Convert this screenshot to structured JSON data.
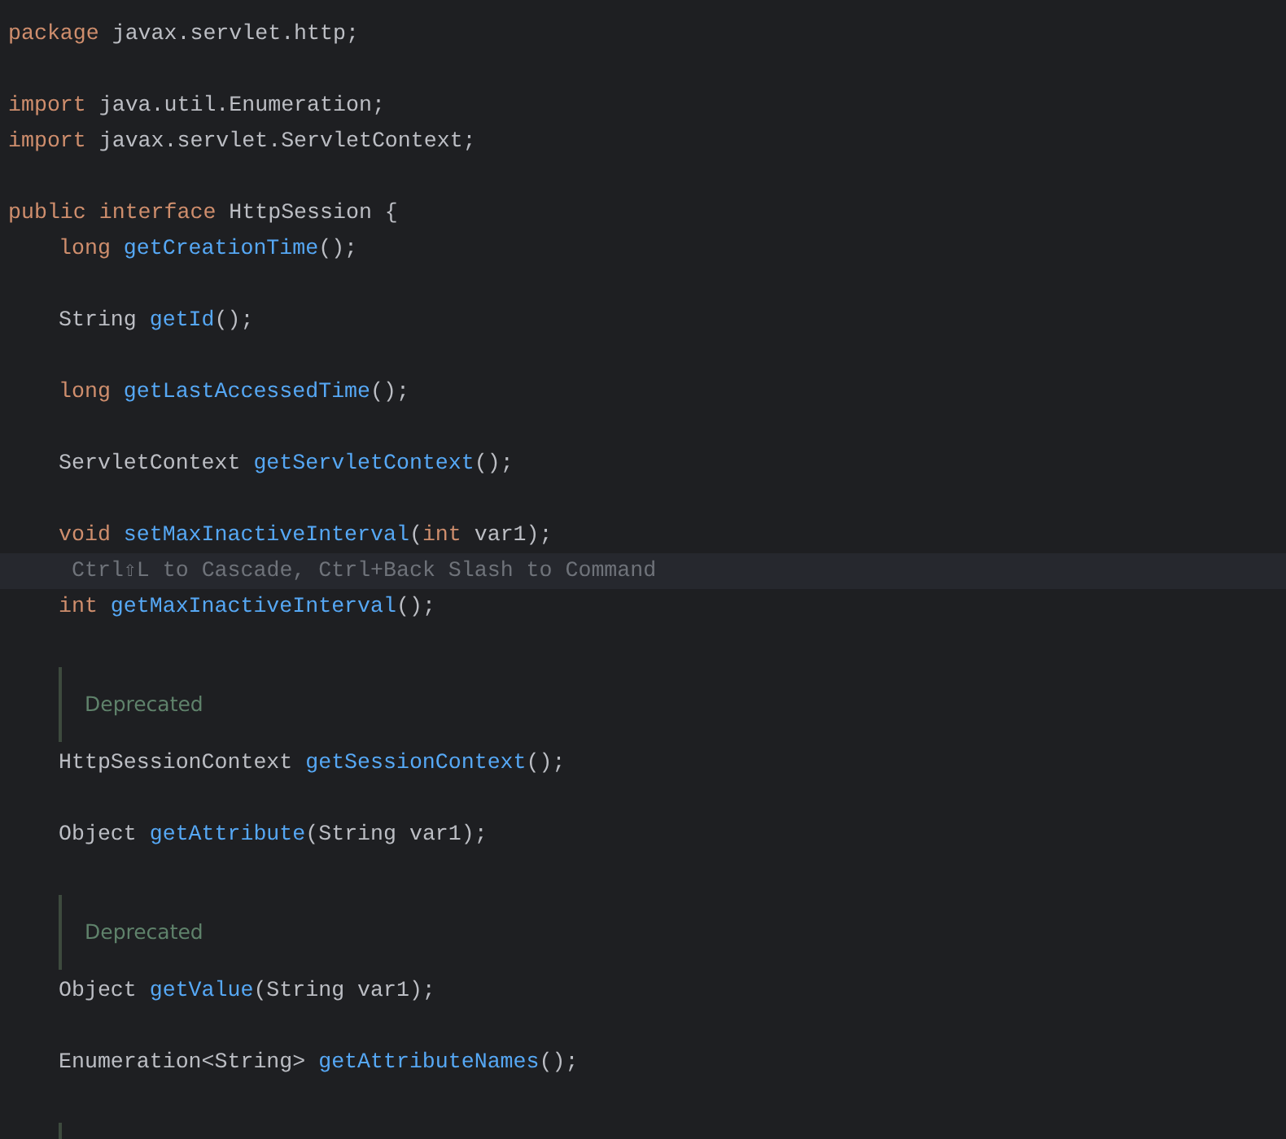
{
  "lines": [
    {
      "kind": "code",
      "tokens": [
        {
          "kind": "keyword",
          "text": "package"
        },
        {
          "kind": "plain",
          "text": " javax.servlet.http;"
        }
      ]
    },
    {
      "kind": "blank"
    },
    {
      "kind": "code",
      "tokens": [
        {
          "kind": "keyword",
          "text": "import"
        },
        {
          "kind": "plain",
          "text": " java.util.Enumeration;"
        }
      ]
    },
    {
      "kind": "code",
      "tokens": [
        {
          "kind": "keyword",
          "text": "import"
        },
        {
          "kind": "plain",
          "text": " javax.servlet.ServletContext;"
        }
      ]
    },
    {
      "kind": "blank"
    },
    {
      "kind": "code",
      "tokens": [
        {
          "kind": "keyword",
          "text": "public interface"
        },
        {
          "kind": "plain",
          "text": " HttpSession {"
        }
      ],
      "children": [
        {
          "kind": "code",
          "tokens": [
            {
              "kind": "keyword",
              "text": "long"
            },
            {
              "kind": "method",
              "text": " getCreationTime"
            },
            {
              "kind": "plain",
              "text": "();"
            }
          ]
        },
        {
          "kind": "blank"
        },
        {
          "kind": "code",
          "tokens": [
            {
              "kind": "plain",
              "text": "String "
            },
            {
              "kind": "method",
              "text": "getId"
            },
            {
              "kind": "plain",
              "text": "();"
            }
          ]
        },
        {
          "kind": "blank"
        },
        {
          "kind": "code",
          "tokens": [
            {
              "kind": "keyword",
              "text": "long"
            },
            {
              "kind": "method",
              "text": " getLastAccessedTime"
            },
            {
              "kind": "plain",
              "text": "();"
            }
          ]
        },
        {
          "kind": "blank"
        },
        {
          "kind": "code",
          "tokens": [
            {
              "kind": "plain",
              "text": "ServletContext "
            },
            {
              "kind": "method",
              "text": "getServletContext"
            },
            {
              "kind": "plain",
              "text": "();"
            }
          ]
        },
        {
          "kind": "blank"
        },
        {
          "kind": "code",
          "tokens": [
            {
              "kind": "keyword",
              "text": "void"
            },
            {
              "kind": "method",
              "text": " setMaxInactiveInterval"
            },
            {
              "kind": "plain",
              "text": "("
            },
            {
              "kind": "keyword",
              "text": "int"
            },
            {
              "kind": "plain",
              "text": " var1);"
            }
          ]
        },
        {
          "kind": "hint",
          "text": "Ctrl⇧L to Cascade, Ctrl+Back Slash to Command"
        },
        {
          "kind": "code",
          "tokens": [
            {
              "kind": "keyword",
              "text": "int"
            },
            {
              "kind": "method",
              "text": " getMaxInactiveInterval"
            },
            {
              "kind": "plain",
              "text": "();"
            }
          ]
        },
        {
          "kind": "doc",
          "text": "Deprecated"
        },
        {
          "kind": "code",
          "tokens": [
            {
              "kind": "plain",
              "text": "HttpSessionContext "
            },
            {
              "kind": "method",
              "text": "getSessionContext"
            },
            {
              "kind": "plain",
              "text": "();"
            }
          ]
        },
        {
          "kind": "blank"
        },
        {
          "kind": "code",
          "tokens": [
            {
              "kind": "plain",
              "text": "Object "
            },
            {
              "kind": "method",
              "text": "getAttribute"
            },
            {
              "kind": "plain",
              "text": "(String var1);"
            }
          ]
        },
        {
          "kind": "doc",
          "text": "Deprecated"
        },
        {
          "kind": "code",
          "tokens": [
            {
              "kind": "plain",
              "text": "Object "
            },
            {
              "kind": "method",
              "text": "getValue"
            },
            {
              "kind": "plain",
              "text": "(String var1);"
            }
          ]
        },
        {
          "kind": "blank"
        },
        {
          "kind": "code",
          "tokens": [
            {
              "kind": "plain",
              "text": "Enumeration<String> "
            },
            {
              "kind": "method",
              "text": "getAttributeNames"
            },
            {
              "kind": "plain",
              "text": "();"
            }
          ]
        },
        {
          "kind": "doc"
        }
      ]
    }
  ]
}
